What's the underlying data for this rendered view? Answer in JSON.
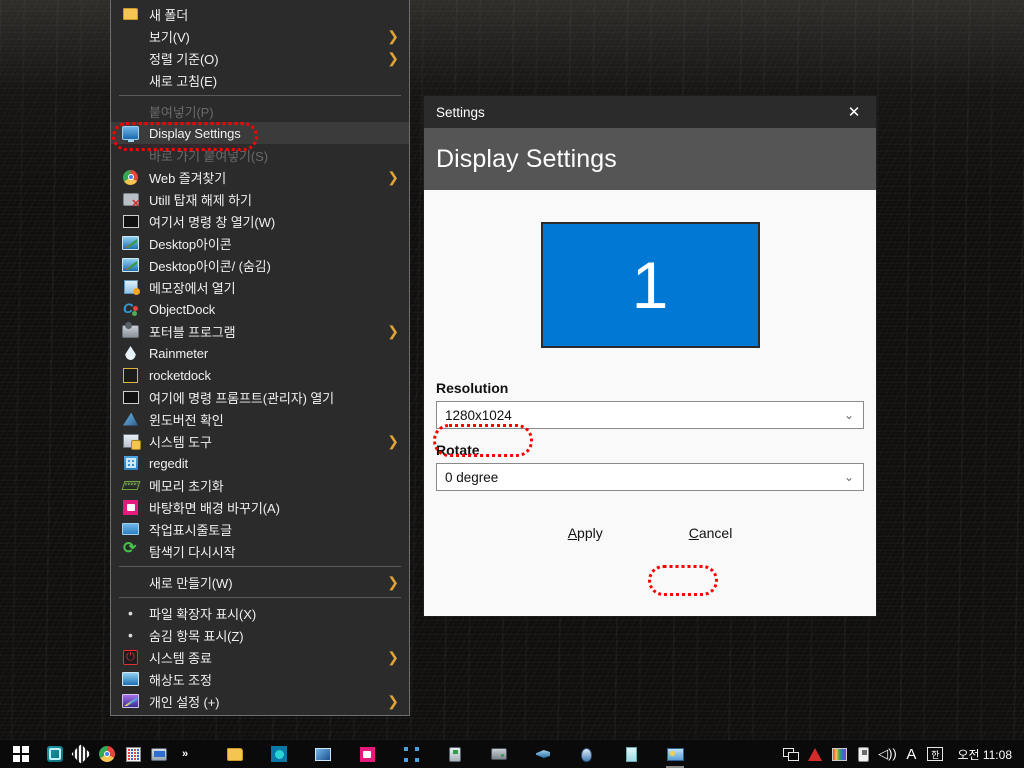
{
  "desktop": {
    "background_color": "#100f0e",
    "description": "dark leather texture wallpaper"
  },
  "context_menu": {
    "items": [
      {
        "label": "새 폴더",
        "icon": "folder-icon",
        "arrow": false,
        "disabled": false,
        "highlighted": false,
        "type": "item"
      },
      {
        "label": "보기(V)",
        "icon": "",
        "arrow": true,
        "disabled": false,
        "highlighted": false,
        "type": "item"
      },
      {
        "label": "정렬 기준(O)",
        "icon": "",
        "arrow": true,
        "disabled": false,
        "highlighted": false,
        "type": "item"
      },
      {
        "label": "새로 고침(E)",
        "icon": "",
        "arrow": false,
        "disabled": false,
        "highlighted": false,
        "type": "item"
      },
      {
        "type": "separator"
      },
      {
        "label": "붙여넣기(P)",
        "icon": "",
        "arrow": false,
        "disabled": true,
        "highlighted": false,
        "type": "item"
      },
      {
        "label": "Display Settings",
        "icon": "monitor-icon",
        "arrow": false,
        "disabled": false,
        "highlighted": true,
        "type": "item"
      },
      {
        "label": "바로 가기 붙여넣기(S)",
        "icon": "",
        "arrow": false,
        "disabled": true,
        "highlighted": false,
        "type": "item"
      },
      {
        "label": "Web 즐겨찾기",
        "icon": "chrome-icon",
        "arrow": true,
        "disabled": false,
        "highlighted": false,
        "type": "item"
      },
      {
        "label": "Utill 탑재 해제 하기",
        "icon": "eject-icon",
        "arrow": false,
        "disabled": false,
        "highlighted": false,
        "type": "item"
      },
      {
        "label": "여기서 명령 창 열기(W)",
        "icon": "command-prompt-icon",
        "arrow": false,
        "disabled": false,
        "highlighted": false,
        "type": "item"
      },
      {
        "label": "Desktop아이콘",
        "icon": "desktop-icon",
        "arrow": false,
        "disabled": false,
        "highlighted": false,
        "type": "item"
      },
      {
        "label": "Desktop아이콘/ (숨김)",
        "icon": "desktop-icon",
        "arrow": false,
        "disabled": false,
        "highlighted": false,
        "type": "item"
      },
      {
        "label": "메모장에서 열기",
        "icon": "notepad-icon",
        "arrow": false,
        "disabled": false,
        "highlighted": false,
        "type": "item"
      },
      {
        "label": "ObjectDock",
        "icon": "objectdock-icon",
        "arrow": false,
        "disabled": false,
        "highlighted": false,
        "type": "item"
      },
      {
        "label": "포터블 프로그램",
        "icon": "portable-drive-icon",
        "arrow": true,
        "disabled": false,
        "highlighted": false,
        "type": "item"
      },
      {
        "label": "Rainmeter",
        "icon": "raindrop-icon",
        "arrow": false,
        "disabled": false,
        "highlighted": false,
        "type": "item"
      },
      {
        "label": "rocketdock",
        "icon": "rocketdock-icon",
        "arrow": false,
        "disabled": false,
        "highlighted": false,
        "type": "item"
      },
      {
        "label": "여기에 명령 프롬프트(관리자) 열기",
        "icon": "command-prompt-icon",
        "arrow": false,
        "disabled": false,
        "highlighted": false,
        "type": "item"
      },
      {
        "label": "윈도버전 확인",
        "icon": "winver-icon",
        "arrow": false,
        "disabled": false,
        "highlighted": false,
        "type": "item"
      },
      {
        "label": "시스템 도구",
        "icon": "system-tools-icon",
        "arrow": true,
        "disabled": false,
        "highlighted": false,
        "type": "item"
      },
      {
        "label": "regedit",
        "icon": "registry-icon",
        "arrow": false,
        "disabled": false,
        "highlighted": false,
        "type": "item"
      },
      {
        "label": "메모리 초기화",
        "icon": "memory-icon",
        "arrow": false,
        "disabled": false,
        "highlighted": false,
        "type": "item"
      },
      {
        "label": "바탕화면 배경 바꾸기(A)",
        "icon": "wallpaper-icon",
        "arrow": false,
        "disabled": false,
        "highlighted": false,
        "type": "item"
      },
      {
        "label": "작업표시줄토글",
        "icon": "taskbar-icon",
        "arrow": false,
        "disabled": false,
        "highlighted": false,
        "type": "item"
      },
      {
        "label": "탐색기 다시시작",
        "icon": "restart-explorer-icon",
        "arrow": false,
        "disabled": false,
        "highlighted": false,
        "type": "item"
      },
      {
        "type": "separator"
      },
      {
        "label": "새로 만들기(W)",
        "icon": "",
        "arrow": true,
        "disabled": false,
        "highlighted": false,
        "type": "item"
      },
      {
        "type": "separator"
      },
      {
        "label": "파일 확장자 표시(X)",
        "icon": "bullet",
        "arrow": false,
        "disabled": false,
        "highlighted": false,
        "type": "item"
      },
      {
        "label": "숨김 항목 표시(Z)",
        "icon": "bullet",
        "arrow": false,
        "disabled": false,
        "highlighted": false,
        "type": "item"
      },
      {
        "label": "시스템 종료",
        "icon": "shutdown-icon",
        "arrow": true,
        "disabled": false,
        "highlighted": false,
        "type": "item"
      },
      {
        "label": "해상도 조정",
        "icon": "resolution-icon",
        "arrow": false,
        "disabled": false,
        "highlighted": false,
        "type": "item"
      },
      {
        "label": "개인 설정 (+)",
        "icon": "personalize-icon",
        "arrow": true,
        "disabled": false,
        "highlighted": false,
        "type": "item"
      }
    ]
  },
  "settings_dialog": {
    "window_title": "Settings",
    "close_glyph": "✕",
    "header_title": "Display Settings",
    "monitor_preview": {
      "number": "1",
      "color": "#0078d4"
    },
    "resolution": {
      "label": "Resolution",
      "value": "1280x1024",
      "chevron": "⌄"
    },
    "rotate": {
      "label": "Rotate",
      "value": "0 degree",
      "chevron": "⌄"
    },
    "buttons": {
      "apply": "Apply",
      "apply_accel": "A",
      "cancel": "Cancel",
      "cancel_accel": "C"
    }
  },
  "annotations": {
    "color": "#ff0000",
    "targets": [
      "Display Settings",
      "1280x1024",
      "Apply"
    ]
  },
  "taskbar": {
    "start_label": "Start",
    "overflow_glyph": "»",
    "pinned": [
      {
        "name": "app-teal-icon"
      },
      {
        "name": "diamond-icon"
      },
      {
        "name": "chrome-icon"
      },
      {
        "name": "calculator-icon"
      },
      {
        "name": "laptop-icon"
      }
    ],
    "running": [
      {
        "name": "folder-explorer-icon"
      },
      {
        "name": "teal-app-icon"
      },
      {
        "name": "blue-image-icon"
      },
      {
        "name": "pink-wallpaper-icon"
      },
      {
        "name": "selection-icon"
      },
      {
        "name": "usb-device-icon"
      },
      {
        "name": "drive-icon"
      },
      {
        "name": "wrench-tool-icon"
      },
      {
        "name": "mouse-icon"
      },
      {
        "name": "document-icon"
      },
      {
        "name": "card-viewer-icon"
      }
    ],
    "tray": [
      {
        "name": "network-icon"
      },
      {
        "name": "red-triangle-icon"
      },
      {
        "name": "rainbow-color-icon"
      },
      {
        "name": "usb-safely-remove-icon"
      },
      {
        "name": "volume-icon",
        "glyph": "◁))"
      },
      {
        "name": "font-icon",
        "glyph": "A"
      },
      {
        "name": "ime-korean-icon",
        "glyph": "한"
      }
    ],
    "clock": "오전 11:08"
  }
}
